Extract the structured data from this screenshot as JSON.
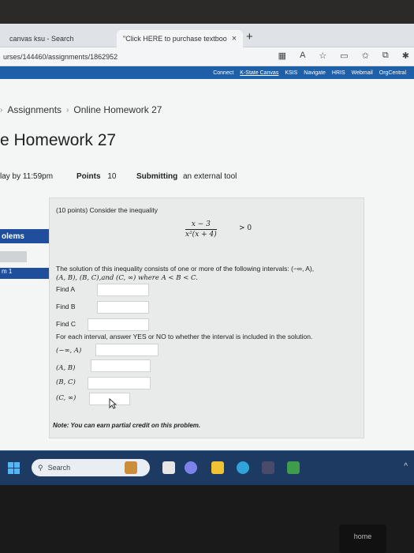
{
  "browser": {
    "tabs": [
      {
        "label": "canvas ksu - Search",
        "close": "×"
      },
      {
        "label": "\"Click HERE to purchase textboo",
        "close": "×"
      }
    ],
    "new_tab": "+",
    "url": "urses/144460/assignments/1862952",
    "bookmarks": [
      "Connect",
      "K-State Canvas",
      "KSIS",
      "Navigate",
      "HRIS",
      "Webmail",
      "OrgCentral"
    ]
  },
  "breadcrumb": {
    "items": [
      "Assignments",
      "Online Homework 27"
    ],
    "separator": "›"
  },
  "page_title": "e Homework 27",
  "meta": {
    "due": "lay by 11:59pm",
    "points_label": "Points",
    "points_value": "10",
    "submitting_label": "Submitting",
    "submitting_value": "an external tool"
  },
  "sidebar": {
    "problems_label": "olems",
    "item1": "m 1"
  },
  "problem": {
    "intro": "(10 points) Consider the inequality",
    "numerator": "x − 3",
    "denominator": "x²(x + 4)",
    "relation": "> 0",
    "desc_line1": "The solution of this inequality consists of one or more of the following intervals: (−∞, A),",
    "desc_line2": "(A, B), (B, C),and (C, ∞) where A < B < C.",
    "find_a": "Find A",
    "find_b": "Find B",
    "find_c": "Find C",
    "instruction": "For each interval, answer YES or NO to whether the interval is included in the solution.",
    "intervals": [
      "(−∞, A)",
      "(A, B)",
      "(B, C)",
      "(C, ∞)"
    ],
    "note": "Note: You can earn partial credit on this problem."
  },
  "taskbar": {
    "search_placeholder": "Search",
    "tray": "^"
  },
  "keyboard": {
    "home_key": "home"
  }
}
